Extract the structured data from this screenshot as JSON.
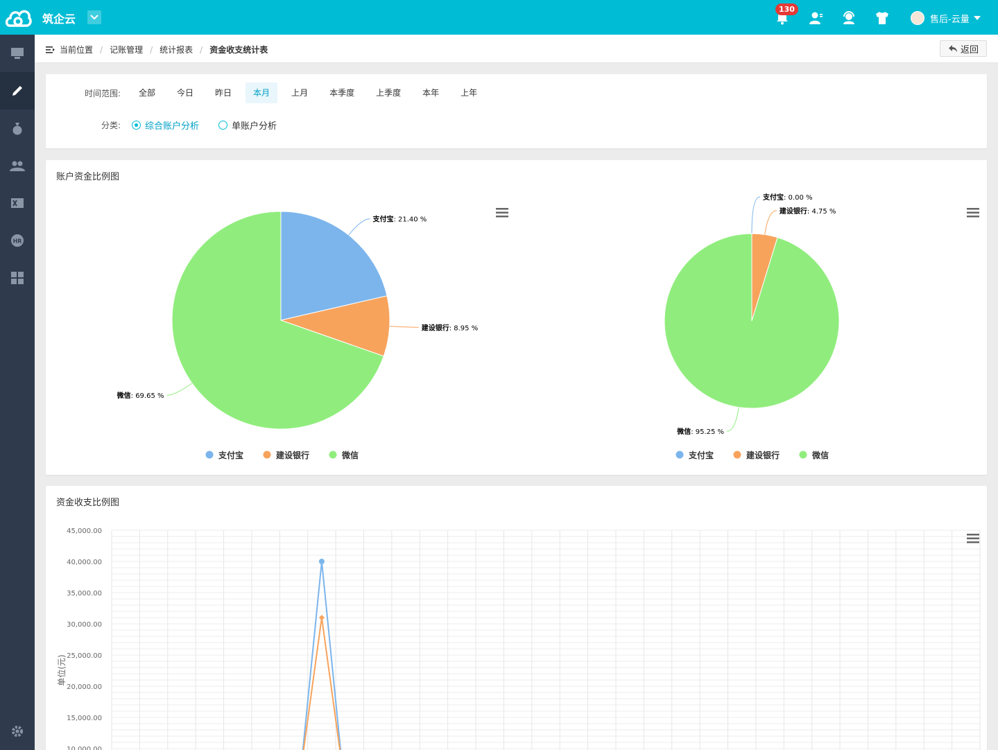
{
  "app": {
    "title": "筑企云"
  },
  "header": {
    "notification_count": "130",
    "user_name": "售后-云量"
  },
  "sidebar": {
    "items": [
      "dashboard",
      "edit",
      "money",
      "users",
      "excel",
      "hr",
      "apps"
    ]
  },
  "breadcrumb": {
    "home": "当前位置",
    "items": [
      "记账管理",
      "统计报表"
    ],
    "current": "资金收支统计表",
    "back_label": "返回"
  },
  "filter": {
    "range_label": "时间范围:",
    "ranges": [
      "全部",
      "今日",
      "昨日",
      "本月",
      "上月",
      "本季度",
      "上季度",
      "本年",
      "上年"
    ],
    "selected_range": "本月",
    "category_label": "分类:",
    "categories": [
      "综合账户分析",
      "单账户分析"
    ],
    "selected_category": "综合账户分析"
  },
  "pie_panel": {
    "title": "账户资金比例图"
  },
  "line_panel": {
    "title": "资金收支比例图"
  },
  "colors": {
    "primary": "#00bcd4",
    "alipay": "#7cb5ec",
    "ccb": "#f7a35c",
    "wechat": "#90ed7d"
  },
  "chart_data": [
    {
      "type": "pie",
      "series": [
        {
          "name": "支付宝",
          "value": 21.4,
          "label": "21.40 %"
        },
        {
          "name": "建设银行",
          "value": 8.95,
          "label": "8.95 %"
        },
        {
          "name": "微信",
          "value": 69.65,
          "label": "69.65 %"
        }
      ],
      "legend": [
        "支付宝",
        "建设银行",
        "微信"
      ]
    },
    {
      "type": "pie",
      "series": [
        {
          "name": "支付宝",
          "value": 0.0,
          "label": "0.00 %"
        },
        {
          "name": "建设银行",
          "value": 4.75,
          "label": "4.75 %"
        },
        {
          "name": "微信",
          "value": 95.25,
          "label": "95.25 %"
        }
      ],
      "legend": [
        "支付宝",
        "建设银行",
        "微信"
      ]
    },
    {
      "type": "line",
      "ylabel": "单位(元)",
      "ylim": [
        10000,
        45000
      ],
      "yticks": [
        "45,000.00",
        "40,000.00",
        "35,000.00",
        "30,000.00",
        "25,000.00",
        "20,000.00",
        "15,000.00",
        "10,000.00"
      ],
      "ytick_values": [
        45000,
        40000,
        35000,
        30000,
        25000,
        20000,
        15000,
        10000
      ],
      "series": [
        {
          "color": "#7cb5ec",
          "peak": 40000,
          "marker": "circle"
        },
        {
          "color": "#f7a35c",
          "peak": 31000,
          "marker": "diamond"
        }
      ]
    }
  ]
}
